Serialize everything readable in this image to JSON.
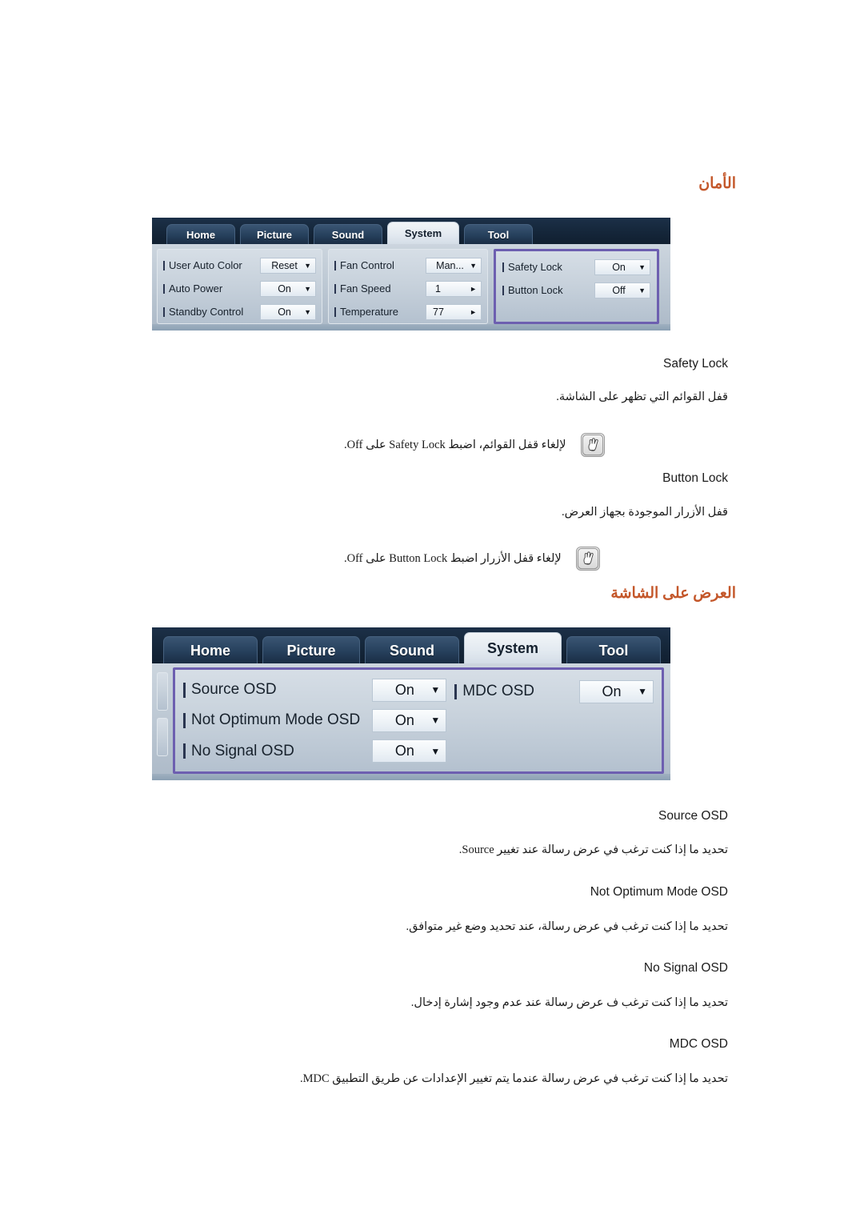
{
  "page": {
    "heading_security": "الأمان",
    "heading_osd": "العرض على الشاشة"
  },
  "colors": {
    "heading": "#c4572a",
    "highlight_border": "#6d5fb0",
    "tabbar": "#16283c",
    "panel": "#c0cbd6"
  },
  "osd_panel_1": {
    "tabs": [
      {
        "label": "Home",
        "active": false
      },
      {
        "label": "Picture",
        "active": false
      },
      {
        "label": "Sound",
        "active": false
      },
      {
        "label": "System",
        "active": true
      },
      {
        "label": "Tool",
        "active": false
      }
    ],
    "groups": [
      {
        "highlighted": false,
        "rows": [
          {
            "label": "User Auto Color",
            "value": "Reset",
            "arrow": "chevron-down"
          },
          {
            "label": "Auto Power",
            "value": "On",
            "arrow": "chevron-down"
          },
          {
            "label": "Standby Control",
            "value": "On",
            "arrow": "chevron-down"
          }
        ]
      },
      {
        "highlighted": false,
        "rows": [
          {
            "label": "Fan Control",
            "value": "Man...",
            "arrow": "chevron-down"
          },
          {
            "label": "Fan Speed",
            "value": "1",
            "arrow": "chevron-right"
          },
          {
            "label": "Temperature",
            "value": "77",
            "arrow": "chevron-right"
          }
        ]
      },
      {
        "highlighted": true,
        "rows": [
          {
            "label": "Safety Lock",
            "value": "On",
            "arrow": "chevron-down"
          },
          {
            "label": "Button Lock",
            "value": "Off",
            "arrow": "chevron-down"
          }
        ]
      }
    ]
  },
  "osd_panel_2": {
    "tabs": [
      {
        "label": "Home",
        "active": false
      },
      {
        "label": "Picture",
        "active": false
      },
      {
        "label": "Sound",
        "active": false
      },
      {
        "label": "System",
        "active": true
      },
      {
        "label": "Tool",
        "active": false
      }
    ],
    "groups": [
      {
        "highlighted": true,
        "rows_left": [
          {
            "label": "Source OSD",
            "value": "On",
            "arrow": "chevron-down"
          },
          {
            "label": "Not Optimum Mode OSD",
            "value": "On",
            "arrow": "chevron-down"
          },
          {
            "label": "No Signal OSD",
            "value": "On",
            "arrow": "chevron-down"
          }
        ],
        "rows_right": [
          {
            "label": "MDC OSD",
            "value": "On",
            "arrow": "chevron-down"
          }
        ]
      }
    ]
  },
  "security_section": {
    "items": [
      {
        "term": "Safety Lock",
        "description": "قفل القوائم التي تظهر على الشاشة.",
        "note": "لإلغاء قفل القوائم، اضبط Safety Lock على Off."
      },
      {
        "term": "Button Lock",
        "description": "قفل الأزرار الموجودة بجهاز العرض.",
        "note": "لإلغاء قفل الأزرار اضبط Button Lock على Off."
      }
    ]
  },
  "osd_section": {
    "items": [
      {
        "term": "Source OSD",
        "description": "تحديد ما إذا كنت ترغب في عرض رسالة عند تغيير Source."
      },
      {
        "term": "Not Optimum Mode OSD",
        "description": "تحديد ما إذا كنت ترغب في عرض رسالة، عند تحديد وضع غير متوافق."
      },
      {
        "term": "No Signal OSD",
        "description": "تحديد ما إذا كنت ترغب ف عرض رسالة عند عدم وجود إشارة إدخال."
      },
      {
        "term": "MDC OSD",
        "description": "تحديد ما إذا كنت ترغب في عرض رسالة عندما يتم تغيير الإعدادات عن طريق التطبيق MDC."
      }
    ]
  }
}
